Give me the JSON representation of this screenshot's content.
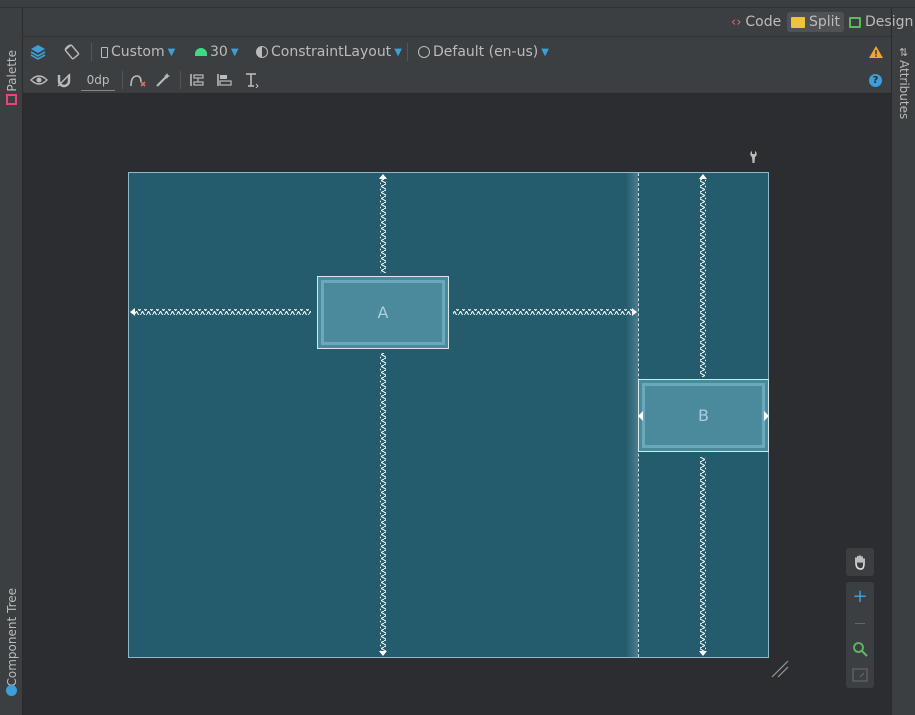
{
  "modes": {
    "code_label": "Code",
    "split_label": "Split",
    "design_label": "Design"
  },
  "toolbar": {
    "device_label": "Custom",
    "api_label": "30",
    "layout_label": "ConstraintLayout",
    "locale_label": "Default (en-us)",
    "margin_value": "0dp"
  },
  "side_panels": {
    "palette_label": "Palette",
    "component_tree_label": "Component Tree",
    "attributes_label": "Attributes"
  },
  "canvas": {
    "widget_a_label": "A",
    "widget_b_label": "B"
  },
  "colors": {
    "canvas_bg": "#245c6e",
    "widget_bg": "#4a8a9c",
    "accent_blue": "#3d9fd8",
    "warning": "#f0a732",
    "android_green": "#3ddc84"
  },
  "icons": {
    "design_layers": "layers-icon",
    "orientation": "rotate-icon",
    "device": "phone-icon",
    "api": "android-icon",
    "theme": "theme-icon",
    "locale": "globe-icon",
    "warning": "warning-icon",
    "help": "help-icon",
    "view_options": "eye-icon",
    "autoconnect": "magnet-icon",
    "clear_constraints": "clear-constraints-icon",
    "infer_constraints": "magic-wand-icon",
    "pack": "pack-icon",
    "align": "align-icon",
    "guidelines": "guideline-icon",
    "pan": "hand-icon",
    "zoom_in": "plus-icon",
    "zoom_out": "minus-icon",
    "zoom_fit": "zoom-fit-icon",
    "zoom_actual": "zoom-actual-icon",
    "resize": "resize-handle-icon",
    "wrench": "wrench-icon"
  }
}
